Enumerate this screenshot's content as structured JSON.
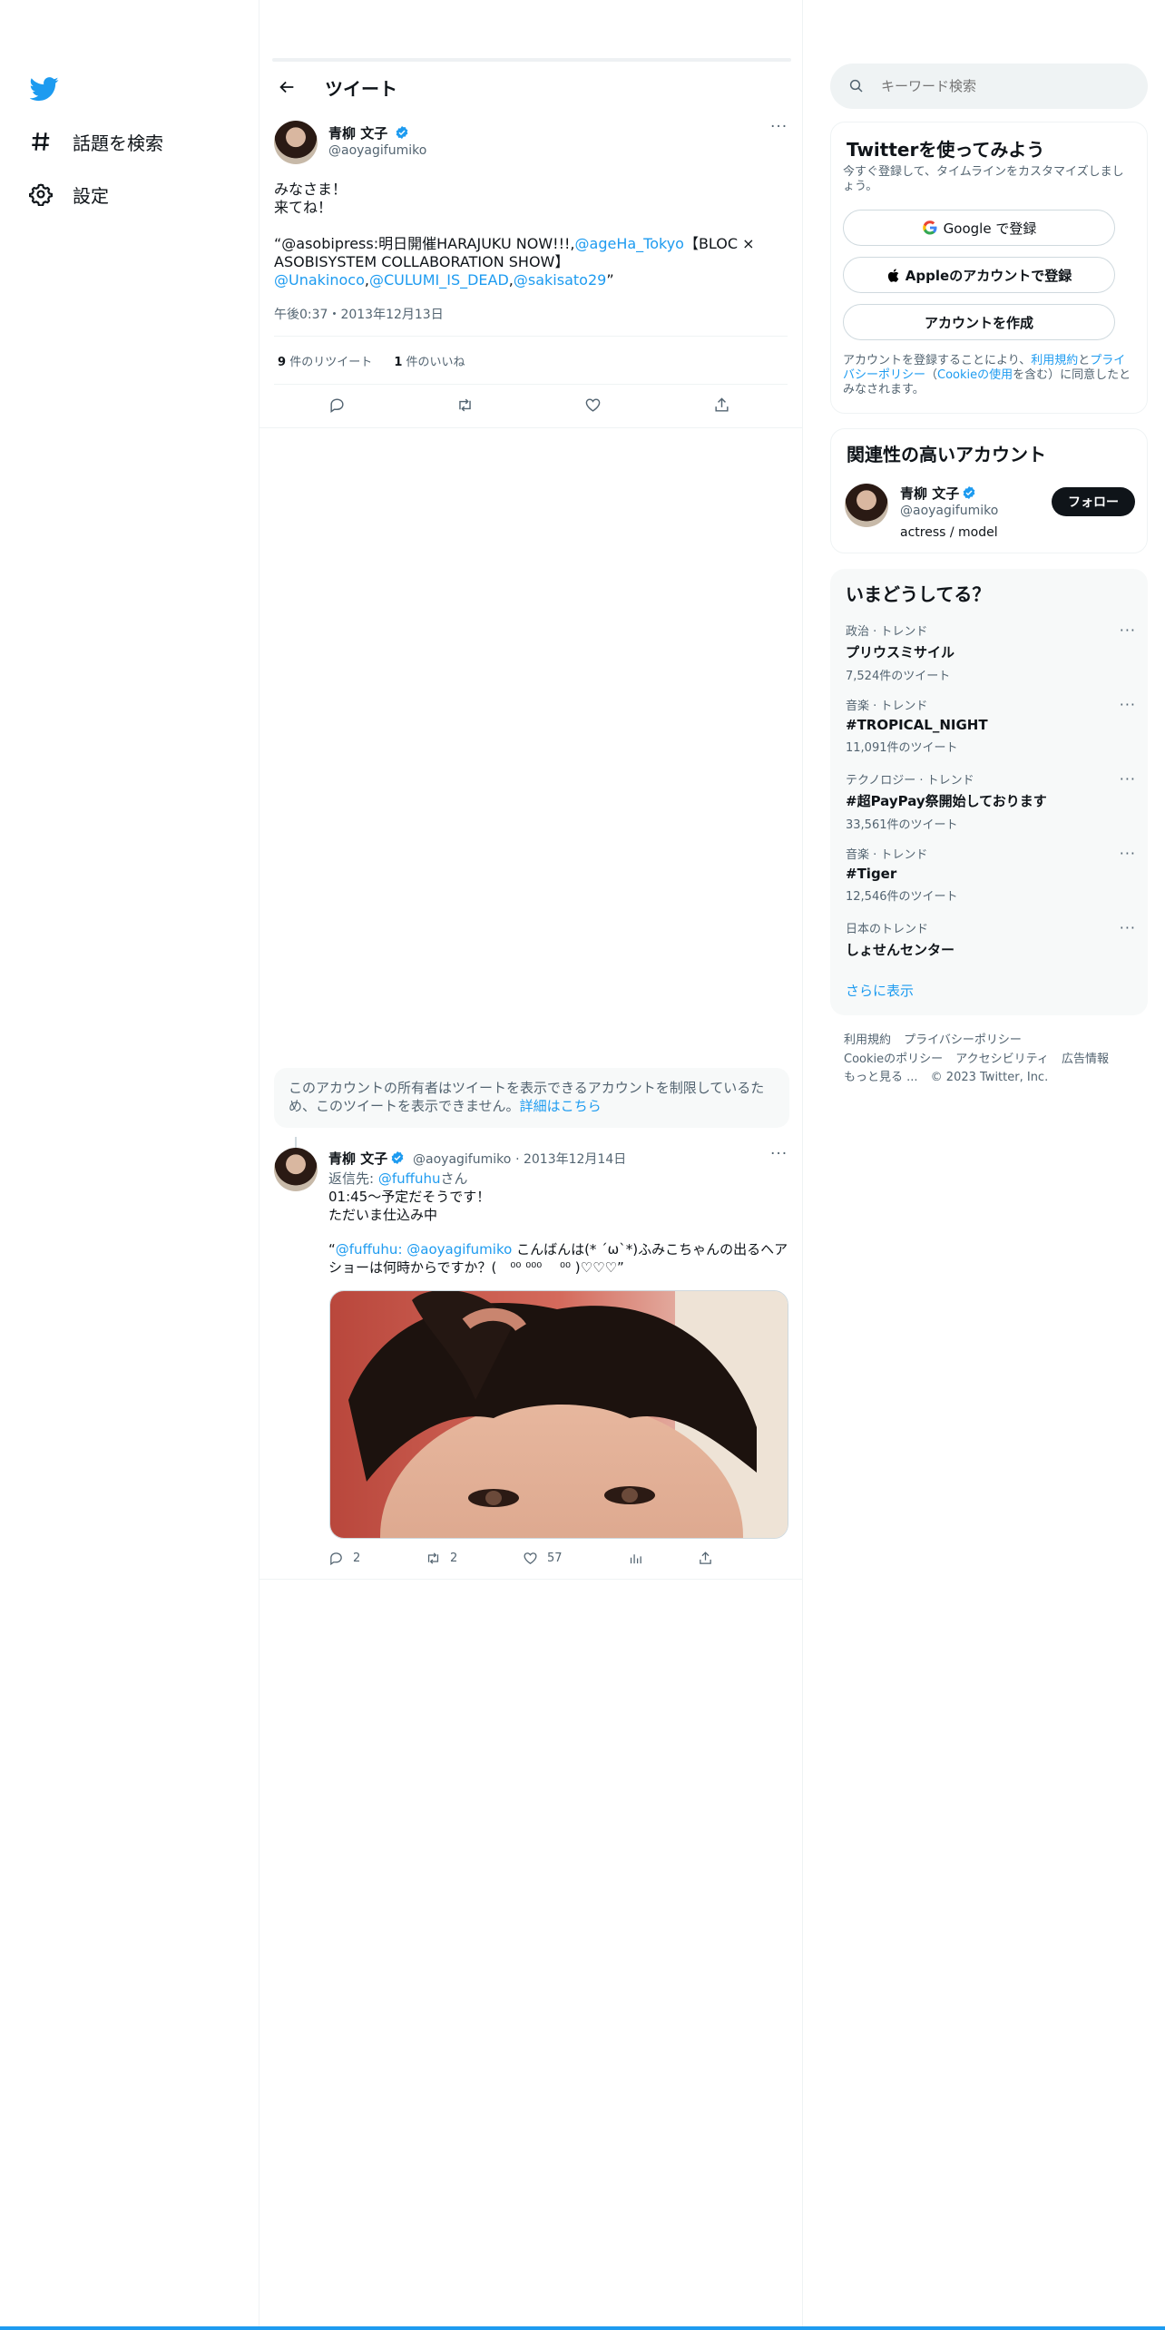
{
  "nav": {
    "explore_label": "話題を検索",
    "settings_label": "設定"
  },
  "header": {
    "title": "ツイート"
  },
  "tweet": {
    "name": "青柳 文子",
    "handle": "@aoyagifumiko",
    "line1": "みなさま！",
    "line2": "来てね！",
    "quote_start": "“@asobipress:明日開催HARAJUKU NOW!!!,",
    "mention_ageha": "@ageHa_Tokyo",
    "quote_mid": "【BLOC × ASOBISYSTEM COLLABORATION SHOW】",
    "mention_unakinoco": "@Unakinoco",
    "comma1": ",",
    "mention_culumi": "@CULUMI_IS_DEAD",
    "comma2": ",",
    "mention_sakisato": "@sakisato29",
    "quote_end": "”",
    "timestamp": "午後0:37・2013年12月13日",
    "retweet_count": "9",
    "retweet_label": "件のリツイート",
    "like_count": "1",
    "like_label": "件のいいね"
  },
  "restricted": {
    "text": "このアカウントの所有者はツイートを表示できるアカウントを制限しているため、このツイートを表示できません。",
    "link": "詳細はこちら"
  },
  "reply": {
    "name": "青柳 文子",
    "handle": "@aoyagifumiko",
    "date": "· 2013年12月14日",
    "reply_to_label": "返信先: ",
    "reply_to_user": "@fuffuhu",
    "reply_to_suffix": "さん",
    "line1": "01:45〜予定だそうです！",
    "line2": "ただいま仕込み中",
    "quote_open": "“",
    "mention1": "@fuffuhu",
    "colon": ": ",
    "mention2": "@aoyagifumiko",
    "quote_text": " こんばんは(* ´ω`*)ふみこちゃんの出るヘアショーは何時からですか？(　⁰⁰ ⁰⁰⁰ 　⁰⁰ )♡♡♡”",
    "replies": "2",
    "retweets": "2",
    "likes": "57"
  },
  "search": {
    "placeholder": "キーワード検索"
  },
  "signup": {
    "title": "Twitterを使ってみよう",
    "subtitle": "今すぐ登録して、タイムラインをカスタマイズしましょう。",
    "google_button": "Google で登録",
    "apple_button": "Appleのアカウントで登録",
    "create_button": "アカウントを作成",
    "terms_a": "アカウントを登録することにより、",
    "terms_link1": "利用規約",
    "terms_b": "と",
    "terms_link2": "プライバシーポリシー",
    "terms_c": "（",
    "terms_link3": "Cookieの使用",
    "terms_d": "を含む）に同意したとみなされます。"
  },
  "related": {
    "title": "関連性の高いアカウント",
    "name": "青柳 文子",
    "handle": "@aoyagifumiko",
    "bio": "actress / model",
    "follow_button": "フォロー"
  },
  "trends": {
    "title": "いまどうしてる？",
    "items": [
      {
        "category": "政治 · トレンド",
        "name": "プリウスミサイル",
        "count": "7,524件のツイート"
      },
      {
        "category": "音楽 · トレンド",
        "name": "#TROPICAL_NIGHT",
        "count": "11,091件のツイート"
      },
      {
        "category": "テクノロジー · トレンド",
        "name": "#超PayPay祭開始しております",
        "count": "33,561件のツイート"
      },
      {
        "category": "音楽 · トレンド",
        "name": "#Tiger",
        "count": "12,546件のツイート"
      },
      {
        "category": "日本のトレンド",
        "name": "しょせんセンター",
        "count": ""
      }
    ],
    "more_dots": "···",
    "show_more": "さらに表示"
  },
  "footer": {
    "terms": "利用規約",
    "privacy": "プライバシーポリシー",
    "cookie": "Cookieのポリシー",
    "accessibility": "アクセシビリティ",
    "ads": "広告情報",
    "more": "もっと見る ...",
    "copyright": "© 2023 Twitter, Inc."
  },
  "colors": {
    "accent": "#1d9bf0",
    "text": "#0f1419",
    "secondary": "#536471",
    "border": "#eff3f4"
  }
}
